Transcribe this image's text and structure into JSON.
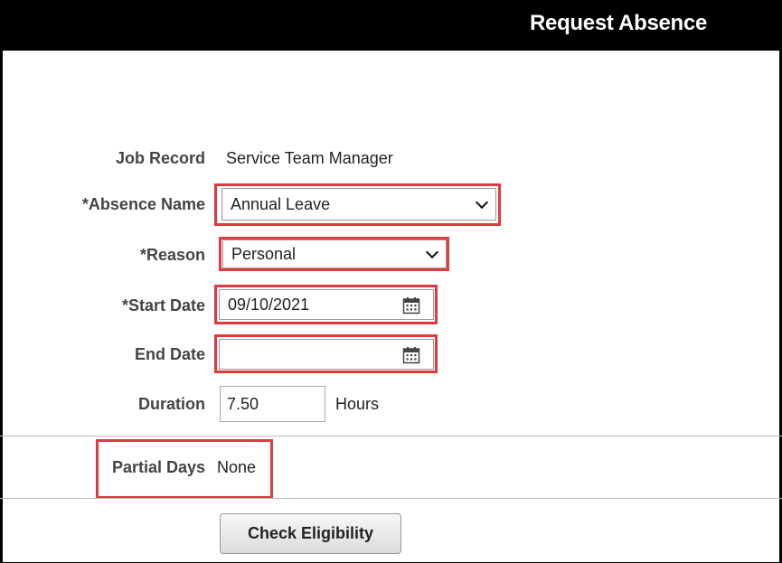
{
  "header": {
    "title": "Request Absence"
  },
  "form": {
    "job_record": {
      "label": "Job Record",
      "value": "Service Team Manager"
    },
    "absence_name": {
      "label": "*Absence Name",
      "value": "Annual Leave"
    },
    "reason": {
      "label": "*Reason",
      "value": "Personal"
    },
    "start_date": {
      "label": "*Start Date",
      "value": "09/10/2021"
    },
    "end_date": {
      "label": "End Date",
      "value": ""
    },
    "duration": {
      "label": "Duration",
      "value": "7.50",
      "unit": "Hours"
    },
    "partial_days": {
      "label": "Partial Days",
      "value": "None"
    }
  },
  "actions": {
    "check_eligibility": "Check Eligibility"
  },
  "colors": {
    "highlight": "#e0393e",
    "header_bg": "#000000"
  },
  "icons": {
    "calendar": "calendar-icon",
    "dropdown": "chevron-down-icon"
  }
}
